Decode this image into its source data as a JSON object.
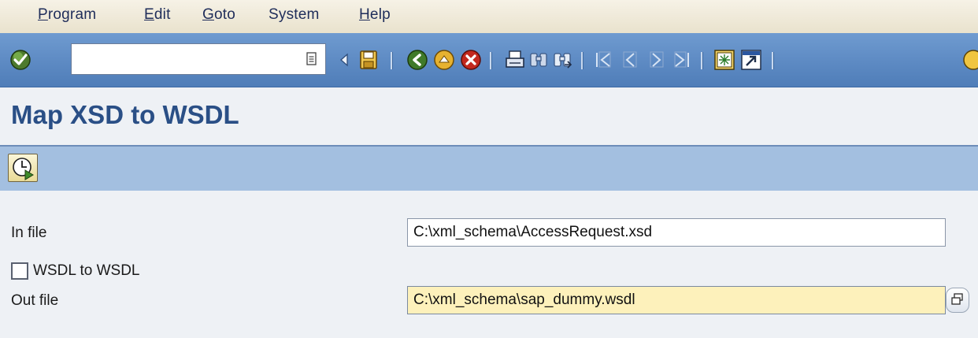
{
  "menubar": {
    "items": [
      {
        "underline": "P",
        "rest": "rogram"
      },
      {
        "underline": "E",
        "rest": "dit"
      },
      {
        "underline": "G",
        "rest": "oto"
      },
      {
        "underline": "",
        "rest": "System"
      },
      {
        "underline": "H",
        "rest": "elp"
      }
    ]
  },
  "toolbar": {
    "command_field_value": "",
    "icons": [
      "enter-icon",
      "command-history-icon",
      "back-arrow-icon",
      "save-icon",
      "back-icon",
      "exit-icon",
      "cancel-icon",
      "print-icon",
      "find-icon",
      "find-next-icon",
      "first-page-icon",
      "previous-page-icon",
      "next-page-icon",
      "last-page-icon",
      "create-session-icon",
      "shortcut-icon",
      "help-icon"
    ]
  },
  "page": {
    "title": "Map XSD to WSDL"
  },
  "app_toolbar": {
    "icons": [
      "execute-icon"
    ]
  },
  "form": {
    "in_file_label": "In file",
    "in_file_value": "C:\\xml_schema\\AccessRequest.xsd",
    "wsdl_checkbox_label": "WSDL to WSDL",
    "wsdl_checkbox_checked": false,
    "out_file_label": "Out file",
    "out_file_value": "C:\\xml_schema\\sap_dummy.wsdl"
  },
  "colors": {
    "toolbar_blue": "#5d8ac3",
    "title_blue": "#2a4f86",
    "app_toolbar_blue": "#a3bfe0",
    "focused_field": "#fdf1bb"
  }
}
